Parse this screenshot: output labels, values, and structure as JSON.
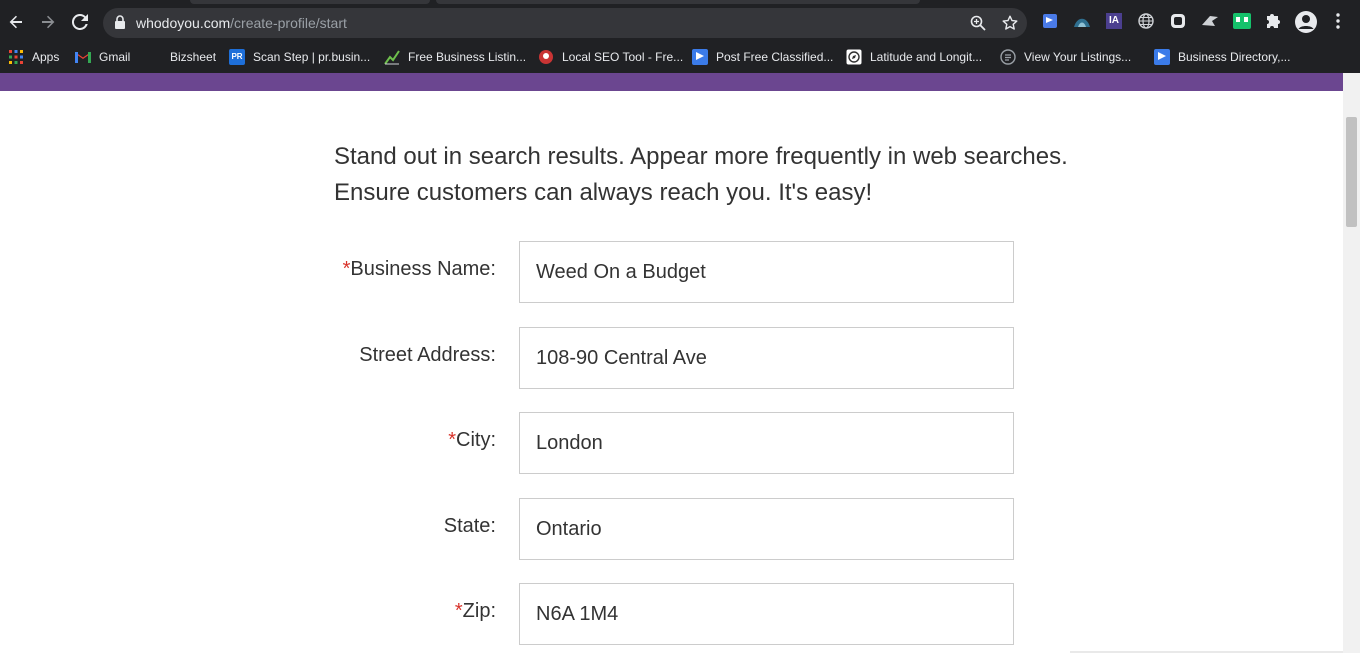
{
  "browser": {
    "url_host": "whodoyou.com",
    "url_path": "/create-profile/start",
    "bookmarks": [
      {
        "label": "Apps",
        "icon": "apps-grid-icon"
      },
      {
        "label": "Gmail",
        "icon": "gmail-icon"
      },
      {
        "label": "Bizsheet",
        "icon": "blank-icon"
      },
      {
        "label": "Scan Step | pr.busin...",
        "icon": "pr-icon"
      },
      {
        "label": "Free Business Listin...",
        "icon": "chart-icon"
      },
      {
        "label": "Local SEO Tool - Fre...",
        "icon": "seo-icon"
      },
      {
        "label": "Post Free Classified...",
        "icon": "flag-icon"
      },
      {
        "label": "Latitude and Longit...",
        "icon": "compass-icon"
      },
      {
        "label": "View Your Listings...",
        "icon": "listing-icon"
      },
      {
        "label": "Business Directory,...",
        "icon": "flag-icon"
      }
    ]
  },
  "page": {
    "intro_line1": "Stand out in search results. Appear more frequently in web searches.",
    "intro_line2": "Ensure customers can always reach you. It's easy!",
    "form": {
      "business_name": {
        "required": "*",
        "label": "Business Name:",
        "value": "Weed On a Budget"
      },
      "street_address": {
        "label": "Street Address:",
        "value": "108-90 Central Ave"
      },
      "city": {
        "required": "*",
        "label": "City:",
        "value": "London"
      },
      "state": {
        "label": "State:",
        "value": "Ontario"
      },
      "zip": {
        "required": "*",
        "label": "Zip:",
        "value": "N6A 1M4"
      }
    }
  },
  "colors": {
    "brand_purple": "#6b4690",
    "required_red": "#d8332b",
    "chrome_dark": "#202124"
  }
}
